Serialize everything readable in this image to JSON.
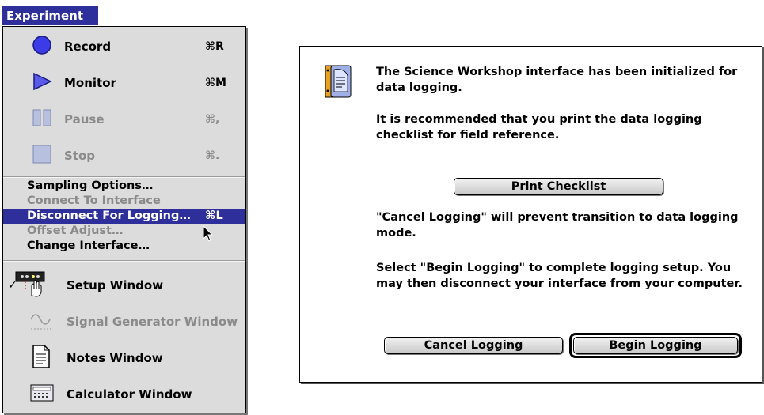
{
  "menu": {
    "title": "Experiment",
    "commands": [
      {
        "label": "Record",
        "shortcut": "⌘R",
        "icon": "record-circle-icon",
        "enabled": true
      },
      {
        "label": "Monitor",
        "shortcut": "⌘M",
        "icon": "monitor-triangle-icon",
        "enabled": true
      },
      {
        "label": "Pause",
        "shortcut": "⌘,",
        "icon": "pause-bars-icon",
        "enabled": false
      },
      {
        "label": "Stop",
        "shortcut": "⌘.",
        "icon": "stop-square-icon",
        "enabled": false
      }
    ],
    "text_items": [
      {
        "label": "Sampling Options…",
        "enabled": true
      },
      {
        "label": "Connect To Interface",
        "enabled": false
      },
      {
        "label": "Disconnect For Logging…",
        "shortcut": "⌘L",
        "enabled": true,
        "highlighted": true
      },
      {
        "label": "Offset Adjust…",
        "enabled": false
      },
      {
        "label": "Change Interface…",
        "enabled": true
      }
    ],
    "windows": [
      {
        "label": "Setup Window",
        "checkmark": "✓",
        "icon": "setup-interface-hand-icon",
        "enabled": true
      },
      {
        "label": "Signal Generator Window",
        "icon": "sine-wave-icon",
        "enabled": false
      },
      {
        "label": "Notes Window",
        "icon": "document-icon",
        "enabled": true
      },
      {
        "label": "Calculator Window",
        "icon": "calculator-icon",
        "enabled": true
      }
    ]
  },
  "dialog": {
    "icon": "note-alert-icon",
    "paragraphs": [
      "The Science Workshop interface has been initialized for data logging.",
      "It is recommended that you print the data logging checklist for field reference.",
      "\"Cancel Logging\" will prevent transition to data logging mode.",
      "Select \"Begin Logging\" to complete logging setup.  You may then disconnect your interface from your computer."
    ],
    "buttons": {
      "print": "Print Checklist",
      "cancel": "Cancel Logging",
      "begin": "Begin Logging"
    }
  },
  "colors": {
    "highlight": "#2e2f9a",
    "menu_bg": "#dcdcdc",
    "record_icon": "#3b3be8",
    "disabled_text": "#8a8a8a"
  }
}
